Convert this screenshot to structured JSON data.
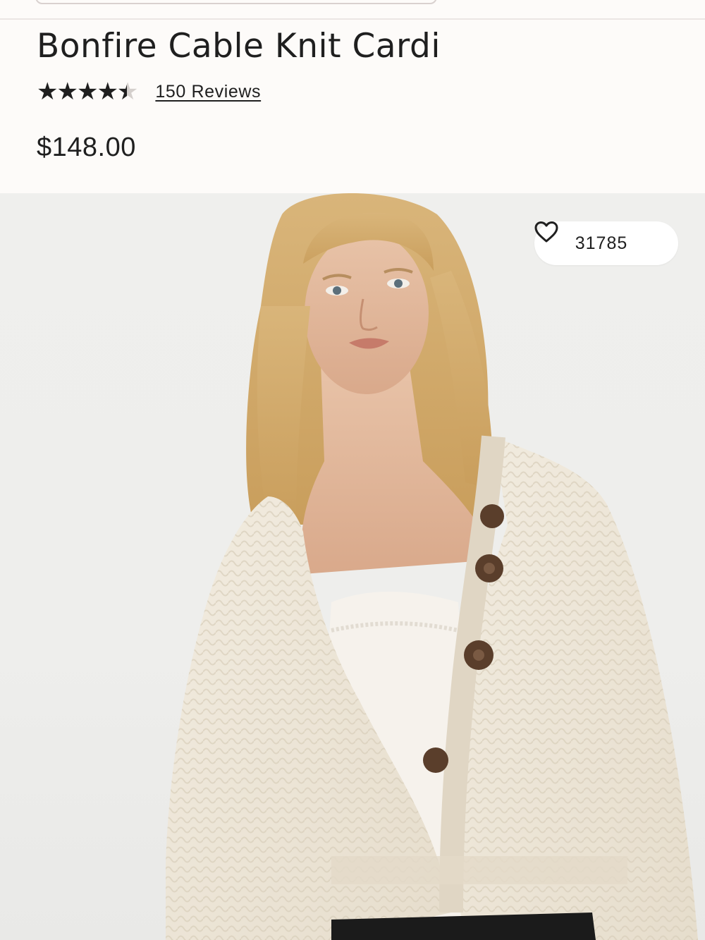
{
  "product": {
    "title": "Bonfire Cable Knit Cardi",
    "rating": 4.5,
    "rating_max": 5,
    "reviews_label": "150 Reviews",
    "price": "$148.00"
  },
  "image": {
    "favorites_count": "31785",
    "heart_icon": "heart-outline-icon"
  },
  "colors": {
    "background": "#fdfbf9",
    "text": "#1f1f1f",
    "cardigan": "#efe8da"
  }
}
